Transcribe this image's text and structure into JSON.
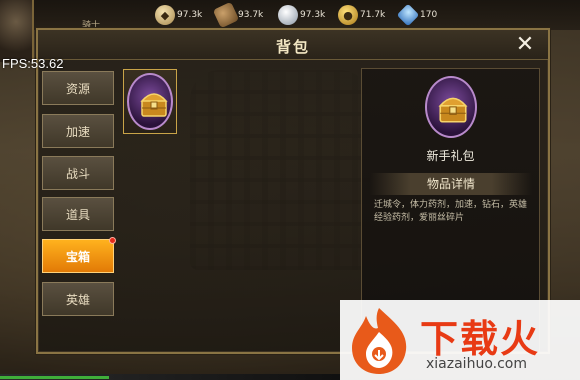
{
  "topbar": {
    "player_name": "骑士",
    "resources": [
      {
        "icon": "food-icon",
        "value": "97.3k"
      },
      {
        "icon": "wood-icon",
        "value": "93.7k"
      },
      {
        "icon": "silver-icon",
        "value": "97.3k"
      },
      {
        "icon": "gold-icon",
        "value": "71.7k"
      },
      {
        "icon": "gem-icon",
        "value": "170"
      }
    ]
  },
  "debug": {
    "fps": "FPS:53.62"
  },
  "panel": {
    "title": "背包",
    "close_icon": "close-icon"
  },
  "tabs": [
    {
      "label": "资源",
      "active": false
    },
    {
      "label": "加速",
      "active": false
    },
    {
      "label": "战斗",
      "active": false
    },
    {
      "label": "道具",
      "active": false
    },
    {
      "label": "宝箱",
      "active": true,
      "badge": true
    },
    {
      "label": "英雄",
      "active": false
    }
  ],
  "inventory": {
    "items": [
      {
        "icon": "treasure-chest-icon",
        "selected": true
      }
    ]
  },
  "detail": {
    "item_name": "新手礼包",
    "section_title": "物品详情",
    "description": "迁城令，体力药剂，加速，钻石，英雄经验药剂，爱丽丝碎片"
  },
  "watermark": {
    "text": "下载火",
    "url": "xiazaihuo.com"
  },
  "colors": {
    "accent": "#f39a12",
    "panel_border": "#8a7444",
    "badge": "#e42a1a"
  },
  "progress": {
    "fraction": 0.32
  }
}
